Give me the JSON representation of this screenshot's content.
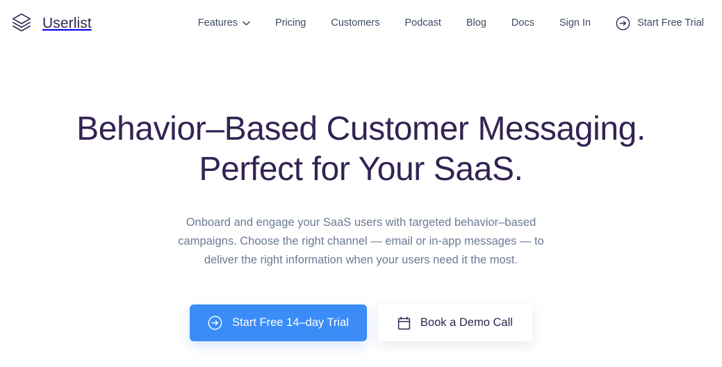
{
  "brand": {
    "name": "Userlist",
    "logo_icon": "stacked-layers-icon"
  },
  "nav": {
    "items": [
      {
        "label": "Features",
        "icon": "chevron-down-icon",
        "has_dropdown": true
      },
      {
        "label": "Pricing",
        "has_dropdown": false
      },
      {
        "label": "Customers",
        "has_dropdown": false
      },
      {
        "label": "Podcast",
        "has_dropdown": false
      },
      {
        "label": "Blog",
        "has_dropdown": false
      },
      {
        "label": "Docs",
        "has_dropdown": false
      },
      {
        "label": "Sign In",
        "has_dropdown": false
      }
    ],
    "cta": {
      "label": "Start Free Trial",
      "icon": "circle-arrow-right-icon"
    }
  },
  "hero": {
    "title_line1": "Behavior–Based Customer Messaging.",
    "title_line2": "Perfect for Your SaaS.",
    "subtitle": "Onboard and engage your SaaS users with targeted behavior–based campaigns. Choose the right channel — email or in-app messages — to deliver the right information when your users need it the most.",
    "primary_cta": {
      "label": "Start Free 14–day Trial",
      "icon": "circle-arrow-right-icon"
    },
    "secondary_cta": {
      "label": "Book a Demo Call",
      "icon": "calendar-icon"
    }
  },
  "colors": {
    "accent_blue": "#3b8cf7",
    "heading_purple": "#332352",
    "nav_text": "#3c4a66",
    "body_text": "#6b7a94",
    "background": "#ffffff"
  }
}
